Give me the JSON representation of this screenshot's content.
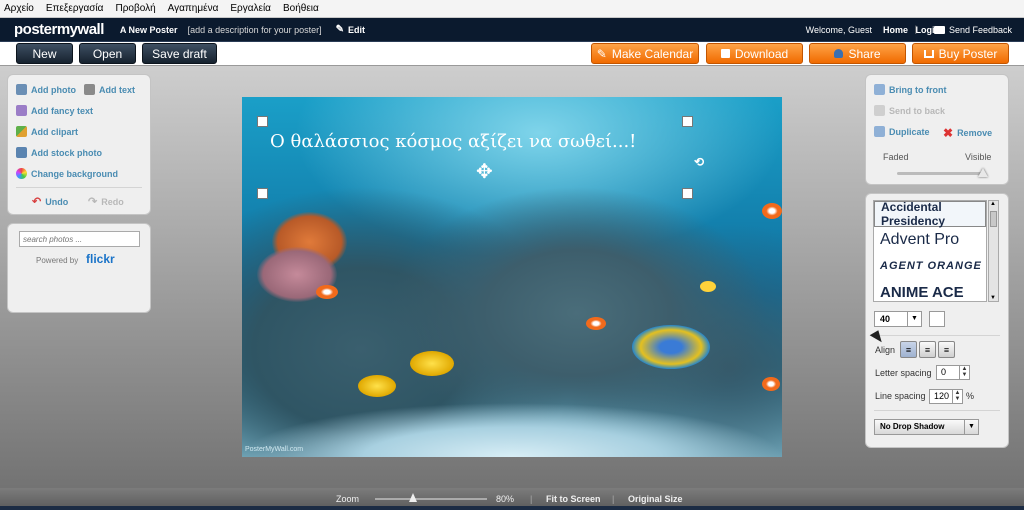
{
  "menu": [
    "Αρχείο",
    "Επεξεργασία",
    "Προβολή",
    "Αγαπημένα",
    "Εργαλεία",
    "Βοήθεια"
  ],
  "topbar": {
    "logo": "postermywall",
    "poster_title": "A New Poster",
    "description": "[add a description for your poster]",
    "edit_label": "Edit",
    "welcome": "Welcome, Guest",
    "home": "Home",
    "separator": "|",
    "login": "Login",
    "feedback": "Send Feedback"
  },
  "toolbar": {
    "new_label": "New",
    "open_label": "Open",
    "save_draft_label": "Save draft",
    "make_calendar_label": "Make Calendar",
    "download_label": "Download",
    "share_label": "Share",
    "buy_poster_label": "Buy Poster"
  },
  "left_panel": {
    "add_photo": "Add photo",
    "add_text": "Add text",
    "add_fancy_text": "Add fancy text",
    "add_clipart": "Add clipart",
    "add_stock_photo": "Add stock photo",
    "change_background": "Change background",
    "undo": "Undo",
    "redo": "Redo",
    "search_placeholder": "search photos ...",
    "powered_by": "Powered by",
    "flickr": "flickr"
  },
  "poster": {
    "text": "Ο θαλάσσιος κόσμος αξίζει να σωθεί...!",
    "watermark": "PosterMyWall.com"
  },
  "right_panel": {
    "bring_to_front": "Bring to front",
    "send_to_back": "Send to back",
    "duplicate": "Duplicate",
    "remove": "Remove",
    "faded": "Faded",
    "visible": "Visible",
    "opacity": 1.0
  },
  "text_panel": {
    "fonts": [
      "Accidental Presidency",
      "Advent Pro",
      "AGENT ORANGE",
      "ANIME ACE"
    ],
    "selected_font": "Accidental Presidency",
    "font_size": "40",
    "align_label": "Align",
    "letter_spacing_label": "Letter spacing",
    "letter_spacing_value": "0",
    "line_spacing_label": "Line spacing",
    "line_spacing_value": "120",
    "line_spacing_unit": "%",
    "shadow": "No Drop Shadow"
  },
  "zoom": {
    "label": "Zoom",
    "value": "80%",
    "fit_to_screen": "Fit to Screen",
    "original_size": "Original Size",
    "separator": "|"
  },
  "colors": {
    "orange": "#f47a10",
    "dark": "#0b1a2e",
    "link": "#4a8cb2"
  }
}
